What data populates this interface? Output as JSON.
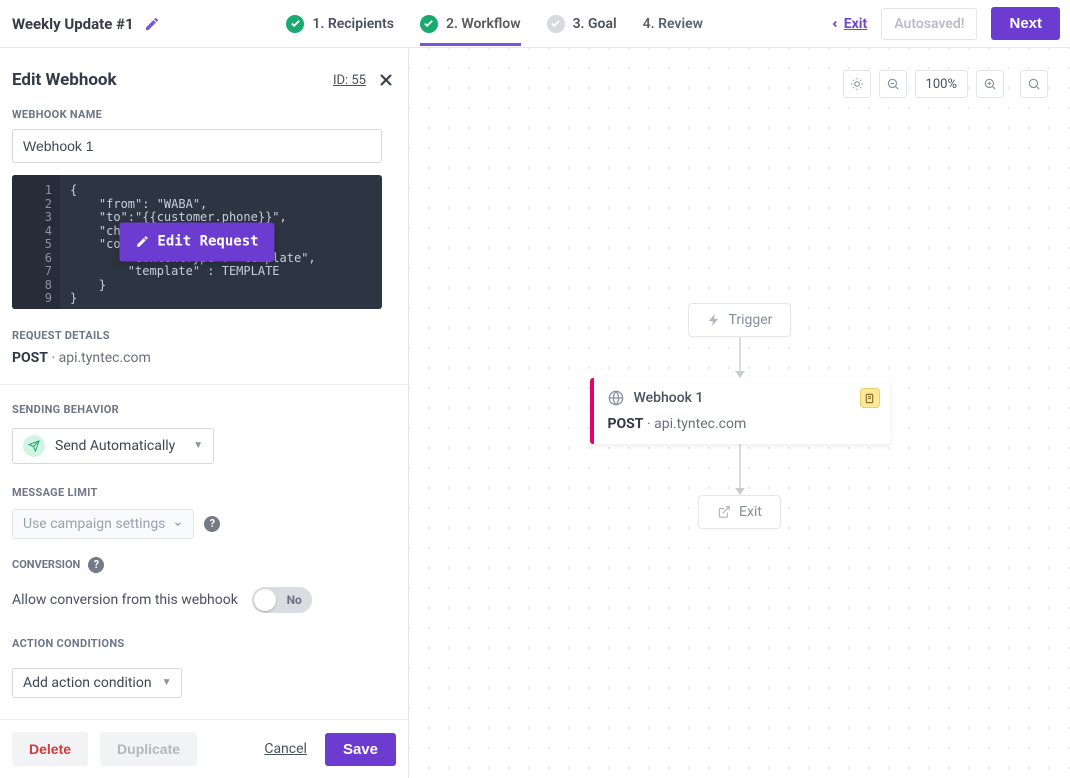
{
  "header": {
    "title": "Weekly Update #1",
    "steps": {
      "recipients": "1. Recipients",
      "workflow": "2. Workflow",
      "goal": "3. Goal",
      "review": "4. Review"
    },
    "exit": "Exit",
    "autosaved": "Autosaved!",
    "next": "Next"
  },
  "panel": {
    "title": "Edit Webhook",
    "id_label": "ID: 55",
    "name_label": "WEBHOOK NAME",
    "name_value": "Webhook 1",
    "code_lines": {
      "l1": "{",
      "l2": "    \"from\": \"WABA\",",
      "l3": "    \"to\":\"{{customer.phone}}\",",
      "l4": "    \"channel\": \"whatsapp\",",
      "l5": "    \"content\": {",
      "l6": "        \"contentType\": \"template\",",
      "l7": "        \"template\" : TEMPLATE",
      "l8": "    }",
      "l9": "}"
    },
    "edit_request": "Edit Request",
    "request_details_label": "REQUEST DETAILS",
    "method": "POST",
    "host": "api.tyntec.com",
    "sending_label": "SENDING BEHAVIOR",
    "sending_value": "Send Automatically",
    "msg_limit_label": "MESSAGE LIMIT",
    "msg_limit_value": "Use campaign settings",
    "conversion_label": "CONVERSION",
    "conversion_text": "Allow conversion from this webhook",
    "toggle_no": "No",
    "action_cond_label": "ACTION CONDITIONS",
    "action_cond_value": "Add action condition",
    "footer": {
      "delete": "Delete",
      "duplicate": "Duplicate",
      "cancel": "Cancel",
      "save": "Save"
    }
  },
  "canvas": {
    "zoom": "100%",
    "trigger": "Trigger",
    "card_title": "Webhook 1",
    "card_method": "POST",
    "card_host": "api.tyntec.com",
    "exit": "Exit"
  }
}
